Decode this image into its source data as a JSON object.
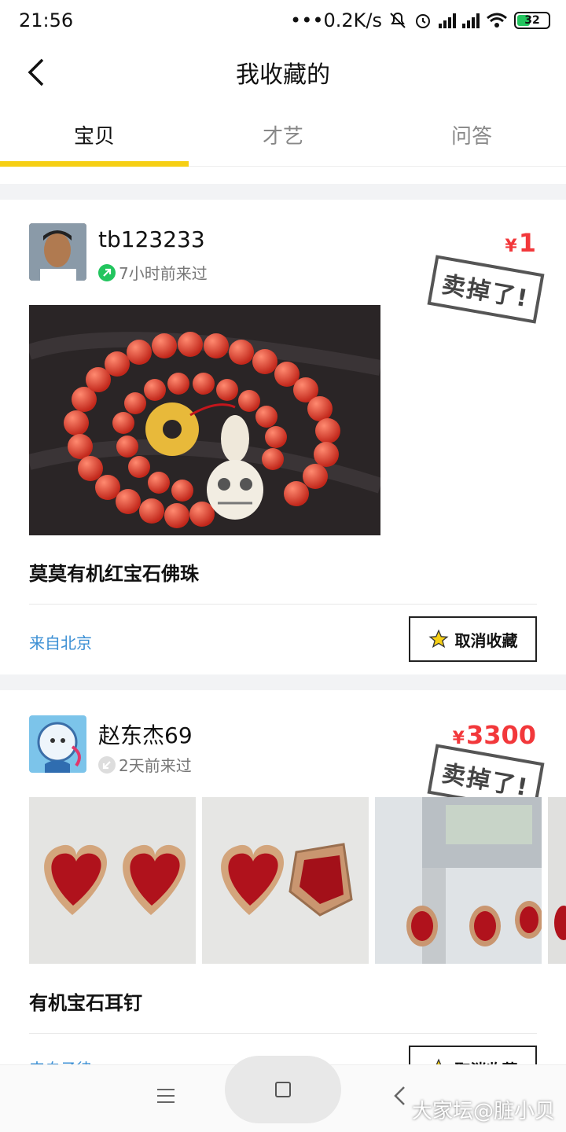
{
  "status_bar": {
    "time": "21:56",
    "network_speed": "•••0.2K/s",
    "battery": "32"
  },
  "header": {
    "title": "我收藏的"
  },
  "tabs": [
    {
      "label": "宝贝",
      "active": true
    },
    {
      "label": "才艺",
      "active": false
    },
    {
      "label": "问答",
      "active": false
    }
  ],
  "items": [
    {
      "username": "tb123233",
      "visited": "7小时前来过",
      "price_symbol": "¥",
      "price": "1",
      "stamp": "卖掉了!",
      "title": "莫莫有机红宝石佛珠",
      "location": "来自北京",
      "unfav_label": "取消收藏"
    },
    {
      "username": "赵东杰69",
      "visited": "2天前来过",
      "price_symbol": "¥",
      "price": "3300",
      "stamp": "卖掉了!",
      "title": "有机宝石耳钉",
      "location": "来自子律",
      "unfav_label": "取消收藏"
    }
  ],
  "watermark": "大家坛@脏小贝",
  "colors": {
    "accent": "#f6cf14",
    "price": "#f2383b",
    "location": "#3b8fd4"
  }
}
